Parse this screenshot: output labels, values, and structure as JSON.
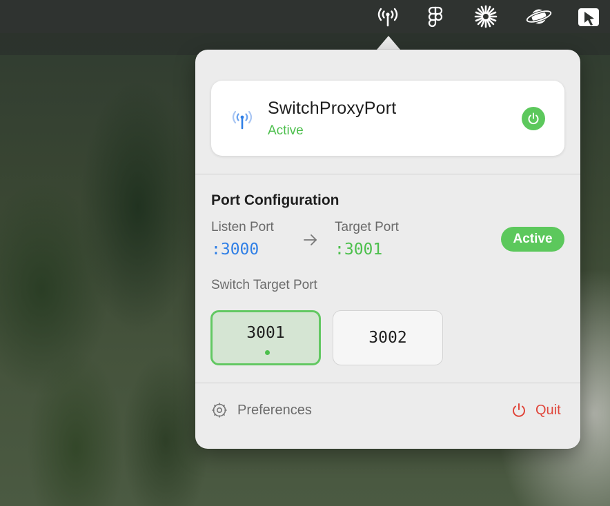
{
  "menubar": {
    "icons": [
      {
        "name": "antenna-icon"
      },
      {
        "name": "figma-icon"
      },
      {
        "name": "asterisk-icon"
      },
      {
        "name": "planet-icon"
      },
      {
        "name": "pointer-window-icon"
      }
    ]
  },
  "app": {
    "name": "SwitchProxyPort",
    "status": "Active"
  },
  "port_config": {
    "title": "Port Configuration",
    "listen_label": "Listen Port",
    "listen_value": ":3000",
    "target_label": "Target Port",
    "target_value": ":3001",
    "status_badge": "Active"
  },
  "switch": {
    "label": "Switch Target Port",
    "options": [
      {
        "value": "3001",
        "selected": true
      },
      {
        "value": "3002",
        "selected": false
      }
    ]
  },
  "footer": {
    "preferences_label": "Preferences",
    "quit_label": "Quit"
  },
  "colors": {
    "accent_green": "#5cc85c",
    "active_text": "#4cbf4c",
    "listen_blue": "#2f7fe6",
    "quit_red": "#e0463b"
  }
}
